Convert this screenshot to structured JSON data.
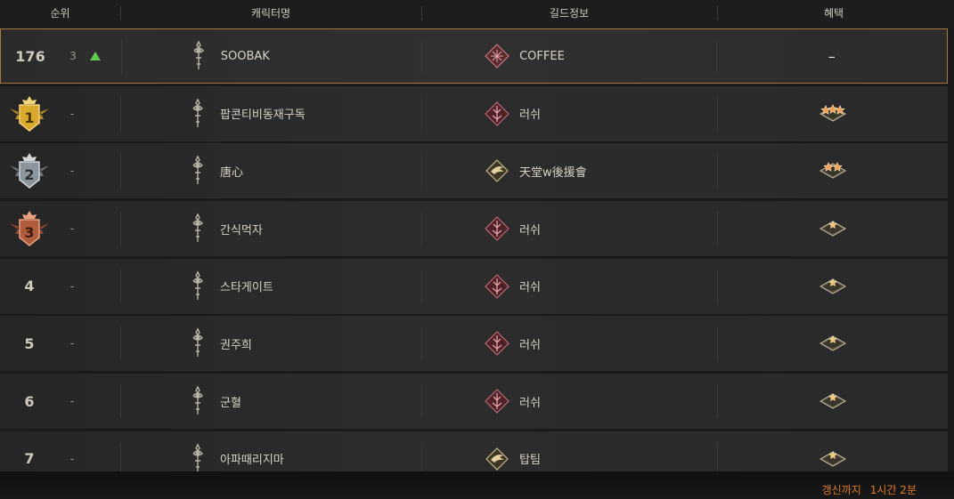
{
  "header": {
    "rank": "순위",
    "character": "캐릭터명",
    "guild": "길드정보",
    "benefit": "혜택"
  },
  "my_row": {
    "rank": "176",
    "change": "3",
    "character": "SOOBAK",
    "guild": "COFFEE",
    "benefit": "–"
  },
  "rows": [
    {
      "rank": "1",
      "change": "-",
      "character": "팝콘티비동재구독",
      "guild": "러쉬",
      "medal": "gold",
      "stars": 3
    },
    {
      "rank": "2",
      "change": "-",
      "character": "唐心",
      "guild": "天堂w後援會",
      "medal": "silver",
      "stars": 2
    },
    {
      "rank": "3",
      "change": "-",
      "character": "간식먹자",
      "guild": "러쉬",
      "medal": "bronze",
      "stars": 1
    },
    {
      "rank": "4",
      "change": "-",
      "character": "스타게이트",
      "guild": "러쉬",
      "medal": "none",
      "stars": 1
    },
    {
      "rank": "5",
      "change": "-",
      "character": "권주희",
      "guild": "러쉬",
      "medal": "none",
      "stars": 1
    },
    {
      "rank": "6",
      "change": "-",
      "character": "군혈",
      "guild": "러쉬",
      "medal": "none",
      "stars": 1
    },
    {
      "rank": "7",
      "change": "-",
      "character": "아파때리지마",
      "guild": "탑팀",
      "medal": "none",
      "stars": 1
    }
  ],
  "footer": {
    "label": "갱신까지",
    "time": "1시간 2분"
  },
  "colors": {
    "highlight_border": "#a87a3e",
    "rank_up": "#5fca4f",
    "footer_text": "#e07a1f"
  }
}
